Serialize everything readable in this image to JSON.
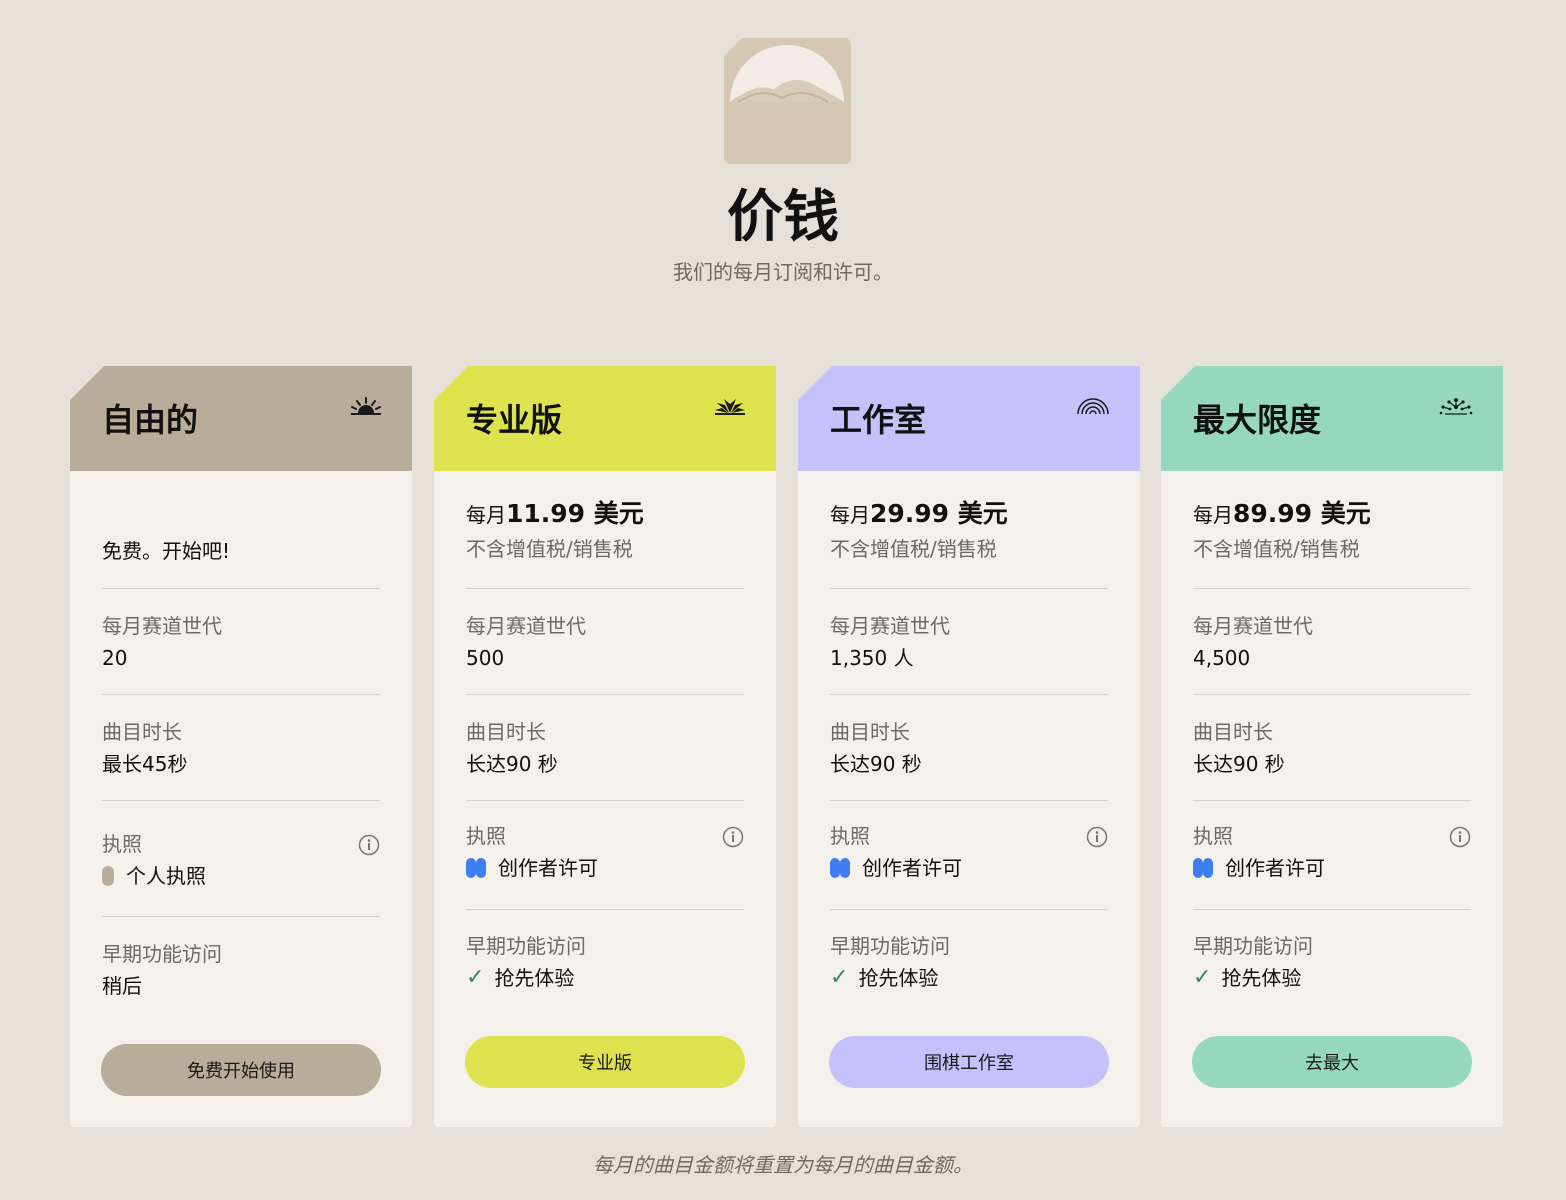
{
  "header": {
    "title": "价钱",
    "subtitle": "我们的每月订阅和许可。"
  },
  "colors": {
    "background": "#e5e1d9",
    "free": "#b8ad98",
    "pro": "#dfe24f",
    "studio": "#c5c2fb",
    "max": "#95d8bd",
    "creator_license": "#3d7ff0"
  },
  "plans": [
    {
      "name": "自由的",
      "icon": "half-sun-icon",
      "price_text": "免费。开始吧!",
      "gen_label": "每月赛道世代",
      "gen_value": "20",
      "duration_label": "曲目时长",
      "duration_value": "最长45秒",
      "license_label": "执照",
      "license_value": "个人执照",
      "early_label": "早期功能访问",
      "early_value": "稍后",
      "button": "免费开始使用"
    },
    {
      "name": "专业版",
      "icon": "fan-icon",
      "price_prefix": "每月",
      "price_amount": "11.99 美元",
      "tax": "不含增值税/销售税",
      "gen_label": "每月赛道世代",
      "gen_value": "500",
      "duration_label": "曲目时长",
      "duration_value": "长达90 秒",
      "license_label": "执照",
      "license_value": "创作者许可",
      "early_label": "早期功能访问",
      "early_value": "抢先体验",
      "button": "专业版"
    },
    {
      "name": "工作室",
      "icon": "rainbow-arcs-icon",
      "price_prefix": "每月",
      "price_amount": "29.99 美元",
      "tax": "不含增值税/销售税",
      "gen_label": "每月赛道世代",
      "gen_value": "1,350 人",
      "duration_label": "曲目时长",
      "duration_value": "长达90 秒",
      "license_label": "执照",
      "license_value": "创作者许可",
      "early_label": "早期功能访问",
      "early_value": "抢先体验",
      "button": "围棋工作室"
    },
    {
      "name": "最大限度",
      "icon": "sparkle-burst-icon",
      "price_prefix": "每月",
      "price_amount": "89.99 美元",
      "tax": "不含增值税/销售税",
      "gen_label": "每月赛道世代",
      "gen_value": "4,500",
      "duration_label": "曲目时长",
      "duration_value": "长达90 秒",
      "license_label": "执照",
      "license_value": "创作者许可",
      "early_label": "早期功能访问",
      "early_value": "抢先体验",
      "button": "去最大"
    }
  ],
  "footnote": "每月的曲目金额将重置为每月的曲目金额。"
}
